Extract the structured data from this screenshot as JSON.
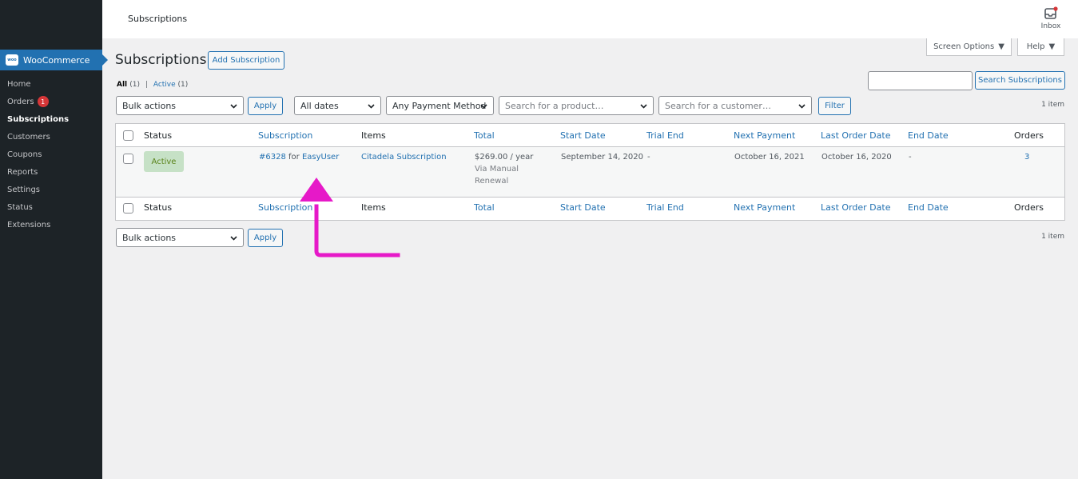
{
  "sidebar": {
    "brand": "WooCommerce",
    "brand_logo": "woo",
    "items": [
      {
        "label": "Home"
      },
      {
        "label": "Orders",
        "badge": "1"
      },
      {
        "label": "Subscriptions"
      },
      {
        "label": "Customers"
      },
      {
        "label": "Coupons"
      },
      {
        "label": "Reports"
      },
      {
        "label": "Settings"
      },
      {
        "label": "Status"
      },
      {
        "label": "Extensions"
      }
    ],
    "current": "Subscriptions"
  },
  "topbar": {
    "breadcrumb": "Subscriptions",
    "inbox_label": "Inbox",
    "screen_options": "Screen Options",
    "help": "Help"
  },
  "page": {
    "title": "Subscriptions",
    "add_button": "Add Subscription",
    "filters": {
      "all_label": "All",
      "all_count": "(1)",
      "separator": "|",
      "active_label": "Active",
      "active_count": "(1)"
    },
    "search_button": "Search Subscriptions",
    "bulk_actions": "Bulk actions",
    "apply": "Apply",
    "dates": "All dates",
    "payment_method": "Any Payment Method",
    "product_placeholder": "Search for a product…",
    "customer_placeholder": "Search for a customer…",
    "filter_button": "Filter",
    "item_count": "1 item"
  },
  "table": {
    "columns": [
      "Status",
      "Subscription",
      "Items",
      "Total",
      "Start Date",
      "Trial End",
      "Next Payment",
      "Last Order Date",
      "End Date",
      "Orders"
    ],
    "rows": [
      {
        "status": "Active",
        "subscription_id": "#6328",
        "subscription_for": "for",
        "customer": "EasyUser",
        "item": "Citadela Subscription",
        "total": "$269.00 / year",
        "payment_via": "Via Manual",
        "payment_via2": "Renewal",
        "start_date": "September 14, 2020",
        "trial_end": "-",
        "next_payment": "October 16, 2021",
        "last_order_date": "October 16, 2020",
        "end_date": "-",
        "orders": "3"
      }
    ]
  },
  "colors": {
    "sidebar_bg": "#1d2327",
    "accent": "#2271b1",
    "active_pill_bg": "#c6e1c6",
    "active_pill_text": "#5b841b",
    "arrow": "#e619c8"
  }
}
